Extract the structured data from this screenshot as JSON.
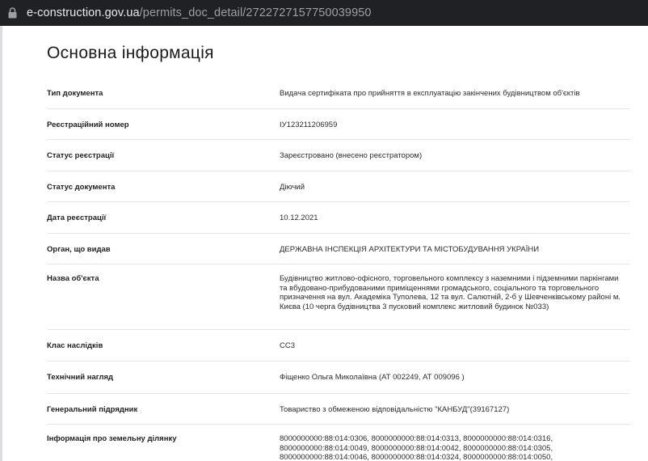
{
  "browser": {
    "url_domain": "e-construction.gov.ua",
    "url_path": "/permits_doc_detail/2722727157750039950",
    "icons": {
      "security": "lock-icon"
    },
    "colors": {
      "bar": "#202124",
      "domain": "#e8eaed",
      "path": "#9aa0a6"
    }
  },
  "page": {
    "title": "Основна інформація",
    "rows": [
      {
        "label": "Тип документа",
        "value": "Видача сертифіката про прийняття в експлуатацію закінчених будівництвом об'єктів"
      },
      {
        "label": "Реєстраційний номер",
        "value": "ІУ123211206959"
      },
      {
        "label": "Статус реєстрації",
        "value": "Зареєстровано (внесено реєстратором)"
      },
      {
        "label": "Статус документа",
        "value": "Діючий"
      },
      {
        "label": "Дата реєстрації",
        "value": "10.12.2021"
      },
      {
        "label": "Орган, що видав",
        "value": "ДЕРЖАВНА ІНСПЕКЦІЯ АРХІТЕКТУРИ ТА МІСТОБУДУВАННЯ УКРАЇНИ"
      },
      {
        "label": "Назва об'єкта",
        "value": "Будівництво житлово-офісного, торговельного комплексу з наземними і підземними паркінгами та вбудовано-прибудованими приміщеннями громадського, соціального та торговельного призначення на вул. Академіка Туполева, 12 та вул. Салютній, 2-б у Шевченківському районі м. Києва (10 черга будівництва 3 пусковий комплекс житловий будинок №033)"
      },
      {
        "label": "Клас наслідків",
        "value": "СС3"
      },
      {
        "label": "Технічний нагляд",
        "value": "Фіщенко Ольга Миколаївна (АТ 002249, АТ 009096 )"
      },
      {
        "label": "Генеральний підрядник",
        "value": "Товариство з обмеженою відповідальністю \"КАНБУД\"(39167127)"
      },
      {
        "label": "Інформація про земельну ділянку",
        "value": "8000000000:88:014:0306, 8000000000:88:014:0313, 8000000000:88:014:0316, 8000000000:88:014:0049, 8000000000:88:014:0042, 8000000000:88:014:0305, 8000000000:88:014:0046, 8000000000:88:014:0324, 8000000000:88:014:0050,"
      }
    ]
  }
}
